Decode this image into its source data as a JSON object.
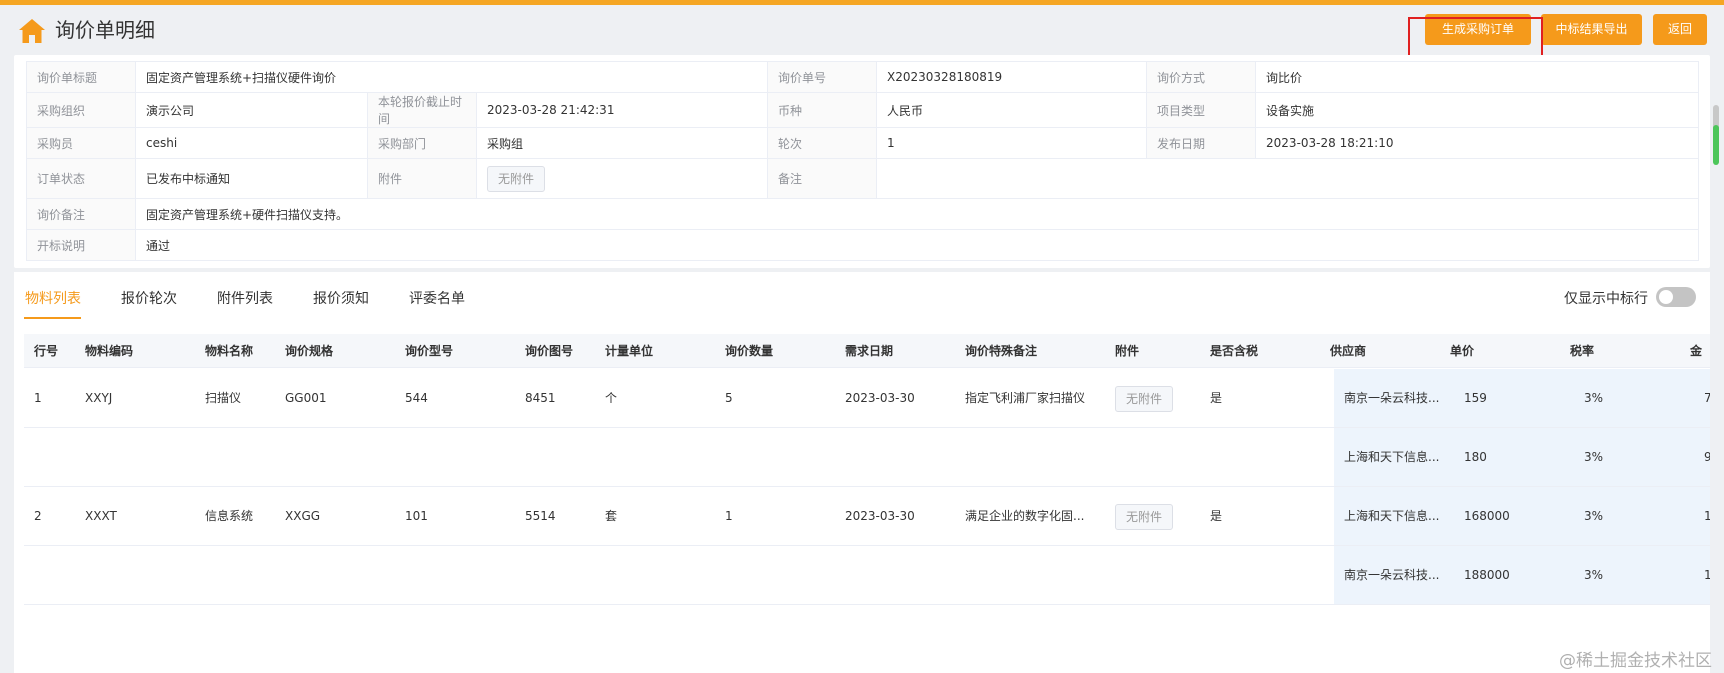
{
  "header": {
    "title": "询价单明细",
    "buttons": {
      "generate_po": "生成采购订单",
      "export_result": "中标结果导出",
      "back": "返回"
    }
  },
  "info": {
    "title_label": "询价单标题",
    "title_value": "固定资产管理系统+扫描仪硬件询价",
    "no_label": "询价单号",
    "no_value": "X20230328180819",
    "method_label": "询价方式",
    "method_value": "询比价",
    "org_label": "采购组织",
    "org_value": "演示公司",
    "deadline_label": "本轮报价截止时间",
    "deadline_value": "2023-03-28 21:42:31",
    "currency_label": "币种",
    "currency_value": "人民币",
    "project_type_label": "项目类型",
    "project_type_value": "设备实施",
    "buyer_label": "采购员",
    "buyer_value": "ceshi",
    "dept_label": "采购部门",
    "dept_value": "采购组",
    "round_label": "轮次",
    "round_value": "1",
    "publish_label": "发布日期",
    "publish_value": "2023-03-28 18:21:10",
    "status_label": "订单状态",
    "status_value": "已发布中标通知",
    "attach_label": "附件",
    "attach_value": "无附件",
    "remark_label": "备注",
    "remark_value": "",
    "inquiry_remark_label": "询价备注",
    "inquiry_remark_value": "固定资产管理系统+硬件扫描仪支持。",
    "bid_note_label": "开标说明",
    "bid_note_value": "通过"
  },
  "tabs": [
    "物料列表",
    "报价轮次",
    "附件列表",
    "报价须知",
    "评委名单"
  ],
  "toggle_label": "仅显示中标行",
  "table": {
    "headers": [
      "行号",
      "物料编码",
      "物料名称",
      "询价规格",
      "询价型号",
      "询价图号",
      "计量单位",
      "询价数量",
      "需求日期",
      "询价特殊备注",
      "附件",
      "是否含税",
      "供应商",
      "单价",
      "税率",
      "金"
    ],
    "rows": [
      {
        "line": "1",
        "code": "XXYJ",
        "name": "扫描仪",
        "spec": "GG001",
        "model": "544",
        "drawing": "8451",
        "unit": "个",
        "qty": "5",
        "date": "2023-03-30",
        "note": "指定飞利浦厂家扫描仪",
        "attach": "无附件",
        "tax": "是",
        "supplier": "南京一朵云科技...",
        "price": "159",
        "rate": "3%",
        "amount": "7"
      },
      {
        "line": "",
        "code": "",
        "name": "",
        "spec": "",
        "model": "",
        "drawing": "",
        "unit": "",
        "qty": "",
        "date": "",
        "note": "",
        "attach": "",
        "tax": "",
        "supplier": "上海和天下信息...",
        "price": "180",
        "rate": "3%",
        "amount": "9"
      },
      {
        "line": "2",
        "code": "XXXT",
        "name": "信息系统",
        "spec": "XXGG",
        "model": "101",
        "drawing": "5514",
        "unit": "套",
        "qty": "1",
        "date": "2023-03-30",
        "note": "满足企业的数字化固...",
        "attach": "无附件",
        "tax": "是",
        "supplier": "上海和天下信息...",
        "price": "168000",
        "rate": "3%",
        "amount": "1"
      },
      {
        "line": "",
        "code": "",
        "name": "",
        "spec": "",
        "model": "",
        "drawing": "",
        "unit": "",
        "qty": "",
        "date": "",
        "note": "",
        "attach": "",
        "tax": "",
        "supplier": "南京一朵云科技...",
        "price": "188000",
        "rate": "3%",
        "amount": "1"
      }
    ]
  },
  "watermark": "@稀土掘金技术社区",
  "colors": {
    "accent": "#f59a1b",
    "highlight": "#e02020",
    "supplier_bg": "#edf4fc"
  }
}
